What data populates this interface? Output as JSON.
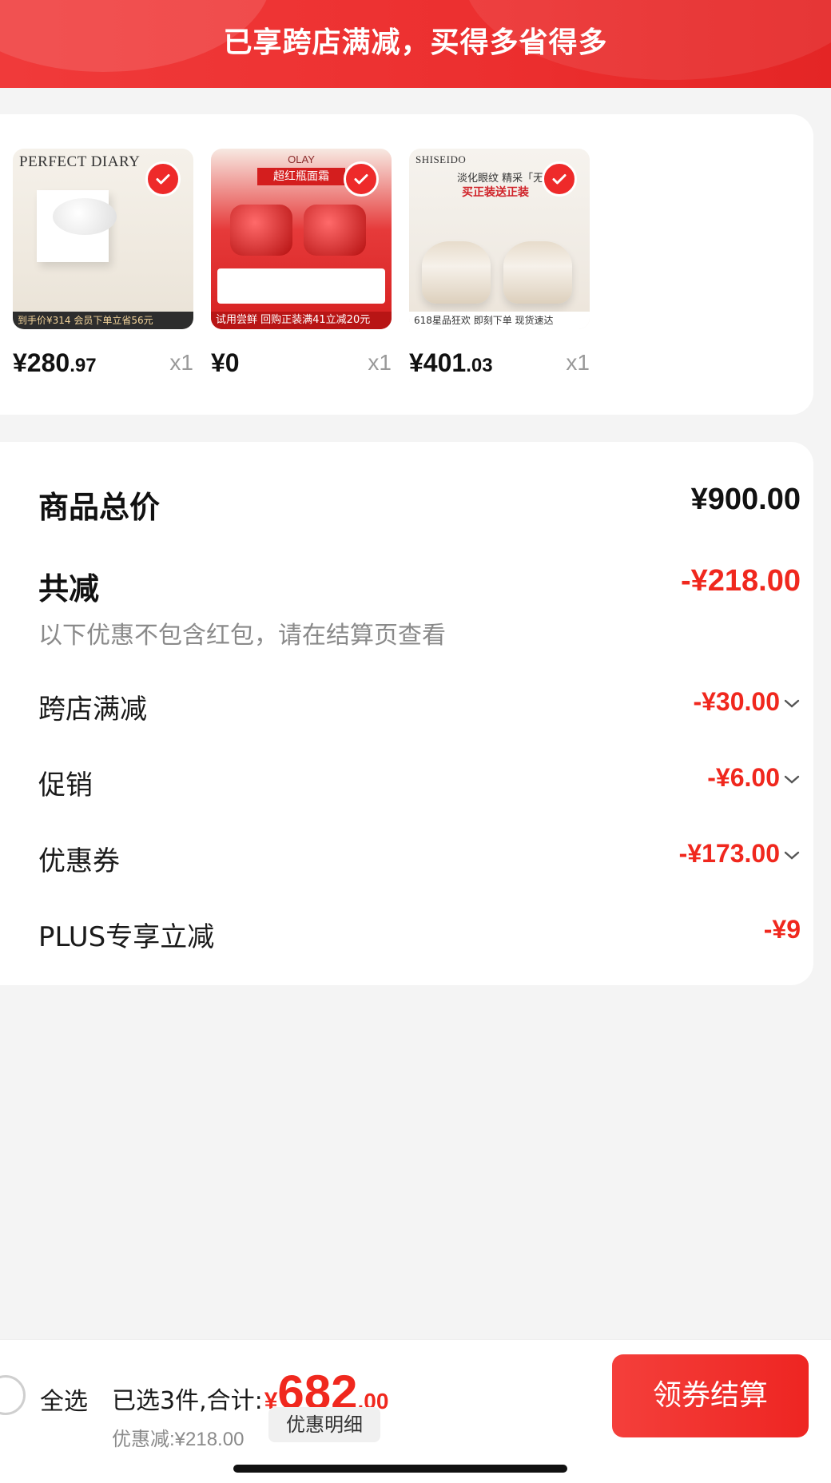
{
  "banner": {
    "title": "已享跨店满减，买得多省得多"
  },
  "products": [
    {
      "brand": "PERFECT DIARY",
      "price_int": "¥280",
      "price_dec": ".97",
      "qty": "x1",
      "promo": "到手价¥314  会员下单立省56元"
    },
    {
      "brand": "OLAY",
      "price_int": "¥0",
      "price_dec": "",
      "qty": "x1",
      "tag": "超红瓶面霜",
      "promo": "试用尝鲜  回购正装满41立减20元"
    },
    {
      "brand": "SHISEIDO",
      "price_int": "¥401",
      "price_dec": ".03",
      "qty": "x1",
      "headline": "淡化眼纹 精采「无线」",
      "headline2": "买正装送正装",
      "promo": "618星品狂欢  即刻下单 现货速达"
    }
  ],
  "summary": {
    "total_label": "商品总价",
    "total_value": "¥900.00",
    "reduce_label": "共减",
    "reduce_value": "-¥218.00",
    "note": "以下优惠不包含红包，请在结算页查看",
    "items": [
      {
        "label": "跨店满减",
        "value": "-¥30.00"
      },
      {
        "label": "促销",
        "value": "-¥6.00"
      },
      {
        "label": "优惠券",
        "value": "-¥173.00"
      },
      {
        "label": "PLUS专享立减",
        "value": "-¥9"
      }
    ]
  },
  "bottom": {
    "select_all": "全选",
    "selected_prefix": "已选3件,合计:",
    "currency": "¥",
    "total_int": "682",
    "total_dec": ".00",
    "discount": "优惠减:¥218.00",
    "detail_button": "优惠明细",
    "checkout_button": "领券结算"
  },
  "colors": {
    "accent": "#f0281e",
    "banner": "#ec2f2f"
  }
}
